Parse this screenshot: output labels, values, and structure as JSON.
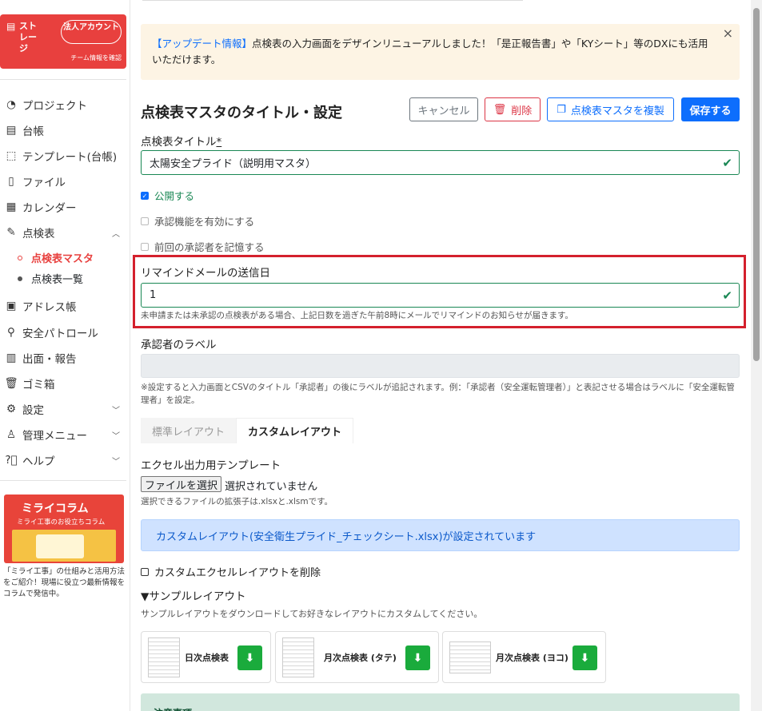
{
  "sidebar": {
    "storage": {
      "label": "ストレージ",
      "account_pill": "法人アカウント",
      "team_link": "チーム情報を確認"
    },
    "items": [
      {
        "label": "プロジェクト",
        "icon": "project-icon"
      },
      {
        "label": "台帳",
        "icon": "ledger-icon"
      },
      {
        "label": "テンプレート(台帳)",
        "icon": "template-icon"
      },
      {
        "label": "ファイル",
        "icon": "file-icon"
      },
      {
        "label": "カレンダー",
        "icon": "calendar-icon"
      },
      {
        "label": "点検表",
        "icon": "checklist-icon"
      },
      {
        "label": "アドレス帳",
        "icon": "address-book-icon"
      },
      {
        "label": "安全パトロール",
        "icon": "patrol-icon"
      },
      {
        "label": "出面・報告",
        "icon": "report-icon"
      },
      {
        "label": "ゴミ箱",
        "icon": "trash-icon"
      },
      {
        "label": "設定",
        "icon": "gear-icon"
      },
      {
        "label": "管理メニュー",
        "icon": "admin-icon"
      },
      {
        "label": "ヘルプ",
        "icon": "help-icon"
      }
    ],
    "subitems": [
      "点検表マスタ",
      "点検表一覧"
    ],
    "banner": {
      "title": "ミライコラム",
      "subtitle": "ミライ工事のお役立ちコラム",
      "text": "「ミライ工事」の仕組みと活用方法をご紹介！現場に役立つ最新情報をコラムで発信中。"
    }
  },
  "alert": {
    "highlight": "【アップデート情報】",
    "text": "点検表の入力画面をデザインリニューアルしました！「是正報告書」や「KYシート」等のDXにも活用いただけます。"
  },
  "header": {
    "title": "点検表マスタのタイトル・設定",
    "cancel": "キャンセル",
    "delete": "削除",
    "duplicate": "点検表マスタを複製",
    "save": "保存する"
  },
  "form": {
    "title_label": "点検表タイトル",
    "required_mark": "*",
    "title_value": "太陽安全プライド（説明用マスタ）",
    "publish": "公開する",
    "approval": "承認機能を有効にする",
    "remember": "前回の承認者を記憶する",
    "remind_label": "リマインドメールの送信日",
    "remind_value": "1",
    "remind_help": "未申請または未承認の点検表がある場合、上記日数を過ぎた午前8時にメールでリマインドのお知らせが届きます。",
    "approver_label": "承認者のラベル",
    "approver_help": "※設定すると入力画面とCSVのタイトル「承認者」の後にラベルが追記されます。例：「承認者（安全運転管理者）」と表記させる場合はラベルに「安全運転管理者」を設定。",
    "tab_standard": "標準レイアウト",
    "tab_custom": "カスタムレイアウト",
    "excel_label": "エクセル出力用テンプレート",
    "file_button": "ファイルを選択",
    "file_none": "選択されていません",
    "file_help": "選択できるファイルの拡張子は.xlsxと.xlsmです。",
    "custom_info": "カスタムレイアウト(安全衛生プライド_チェックシート.xlsx)が設定されています",
    "delete_custom": "カスタムエクセルレイアウトを削除",
    "sample_heading": "▼サンプルレイアウト",
    "sample_help": "サンプルレイアウトをダウンロードしてお好きなレイアウトにカスタムしてください。",
    "samples": [
      "日次点検表",
      "月次点検表 (タテ)",
      "月次点検表 (ヨコ)"
    ],
    "notice": "注意事項"
  }
}
